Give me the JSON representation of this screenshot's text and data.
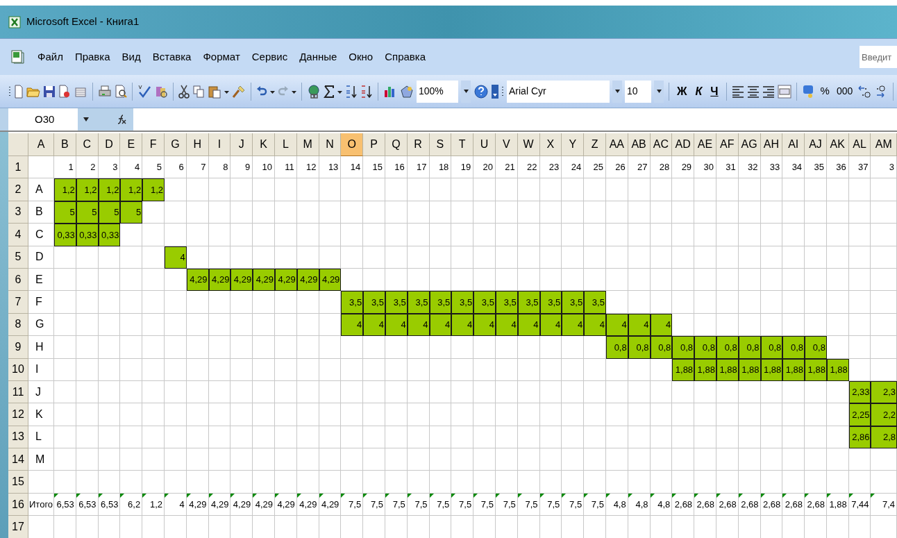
{
  "window": {
    "title": "Microsoft Excel - Книга1"
  },
  "menu": [
    "Файл",
    "Правка",
    "Вид",
    "Вставка",
    "Формат",
    "Сервис",
    "Данные",
    "Окно",
    "Справка"
  ],
  "help_search": {
    "placeholder": "Введит"
  },
  "toolbar": {
    "zoom": "100%",
    "font": "Arial Cyr",
    "font_size": "10",
    "bold": "Ж",
    "italic": "К",
    "underline": "Ч",
    "percent": "%",
    "thousands": "000"
  },
  "formula_bar": {
    "name_box": "O30"
  },
  "sheet": {
    "columns": [
      {
        "label": "A",
        "selected": false
      },
      {
        "label": "B",
        "selected": false
      },
      {
        "label": "C",
        "selected": false
      },
      {
        "label": "D",
        "selected": false
      },
      {
        "label": "E",
        "selected": false
      },
      {
        "label": "F",
        "selected": false
      },
      {
        "label": "G",
        "selected": false
      },
      {
        "label": "H",
        "selected": false
      },
      {
        "label": "I",
        "selected": false
      },
      {
        "label": "J",
        "selected": false
      },
      {
        "label": "K",
        "selected": false
      },
      {
        "label": "L",
        "selected": false
      },
      {
        "label": "M",
        "selected": false
      },
      {
        "label": "N",
        "selected": false
      },
      {
        "label": "O",
        "selected": true
      },
      {
        "label": "P",
        "selected": false
      },
      {
        "label": "Q",
        "selected": false
      },
      {
        "label": "R",
        "selected": false
      },
      {
        "label": "S",
        "selected": false
      },
      {
        "label": "T",
        "selected": false
      },
      {
        "label": "U",
        "selected": false
      },
      {
        "label": "V",
        "selected": false
      },
      {
        "label": "W",
        "selected": false
      },
      {
        "label": "X",
        "selected": false
      },
      {
        "label": "Y",
        "selected": false
      },
      {
        "label": "Z",
        "selected": false
      },
      {
        "label": "AA",
        "selected": false
      },
      {
        "label": "AB",
        "selected": false
      },
      {
        "label": "AC",
        "selected": false
      },
      {
        "label": "AD",
        "selected": false
      },
      {
        "label": "AE",
        "selected": false
      },
      {
        "label": "AF",
        "selected": false
      },
      {
        "label": "AG",
        "selected": false
      },
      {
        "label": "AH",
        "selected": false
      },
      {
        "label": "AI",
        "selected": false
      },
      {
        "label": "AJ",
        "selected": false
      },
      {
        "label": "AK",
        "selected": false
      },
      {
        "label": "AL",
        "selected": false
      },
      {
        "label": "AM",
        "selected": false
      }
    ],
    "rows": [
      {
        "header": "1",
        "flagged": false,
        "cells": [
          null,
          {
            "text": "1",
            "filled": false
          },
          {
            "text": "2",
            "filled": false
          },
          {
            "text": "3",
            "filled": false
          },
          {
            "text": "4",
            "filled": false
          },
          {
            "text": "5",
            "filled": false
          },
          {
            "text": "6",
            "filled": false
          },
          {
            "text": "7",
            "filled": false
          },
          {
            "text": "8",
            "filled": false
          },
          {
            "text": "9",
            "filled": false
          },
          {
            "text": "10",
            "filled": false
          },
          {
            "text": "11",
            "filled": false
          },
          {
            "text": "12",
            "filled": false
          },
          {
            "text": "13",
            "filled": false
          },
          {
            "text": "14",
            "filled": false
          },
          {
            "text": "15",
            "filled": false
          },
          {
            "text": "16",
            "filled": false
          },
          {
            "text": "17",
            "filled": false
          },
          {
            "text": "18",
            "filled": false
          },
          {
            "text": "19",
            "filled": false
          },
          {
            "text": "20",
            "filled": false
          },
          {
            "text": "21",
            "filled": false
          },
          {
            "text": "22",
            "filled": false
          },
          {
            "text": "23",
            "filled": false
          },
          {
            "text": "24",
            "filled": false
          },
          {
            "text": "25",
            "filled": false
          },
          {
            "text": "26",
            "filled": false
          },
          {
            "text": "27",
            "filled": false
          },
          {
            "text": "28",
            "filled": false
          },
          {
            "text": "29",
            "filled": false
          },
          {
            "text": "30",
            "filled": false
          },
          {
            "text": "31",
            "filled": false
          },
          {
            "text": "32",
            "filled": false
          },
          {
            "text": "33",
            "filled": false
          },
          {
            "text": "34",
            "filled": false
          },
          {
            "text": "35",
            "filled": false
          },
          {
            "text": "36",
            "filled": false
          },
          {
            "text": "37",
            "filled": false
          },
          {
            "text": "3",
            "filled": false
          }
        ]
      },
      {
        "header": "2",
        "flagged": false,
        "cells": [
          {
            "text": "A",
            "filled": false
          },
          {
            "text": "1,2",
            "filled": true
          },
          {
            "text": "1,2",
            "filled": true
          },
          {
            "text": "1,2",
            "filled": true
          },
          {
            "text": "1,2",
            "filled": true
          },
          {
            "text": "1,2",
            "filled": true
          }
        ]
      },
      {
        "header": "3",
        "flagged": false,
        "cells": [
          {
            "text": "B",
            "filled": false
          },
          {
            "text": "5",
            "filled": true
          },
          {
            "text": "5",
            "filled": true
          },
          {
            "text": "5",
            "filled": true
          },
          {
            "text": "5",
            "filled": true
          }
        ]
      },
      {
        "header": "4",
        "flagged": false,
        "cells": [
          {
            "text": "C",
            "filled": false
          },
          {
            "text": "0,33",
            "filled": true
          },
          {
            "text": "0,33",
            "filled": true
          },
          {
            "text": "0,33",
            "filled": true
          }
        ]
      },
      {
        "header": "5",
        "flagged": false,
        "cells": [
          {
            "text": "D",
            "filled": false
          },
          null,
          null,
          null,
          null,
          null,
          {
            "text": "4",
            "filled": true
          }
        ]
      },
      {
        "header": "6",
        "flagged": false,
        "cells": [
          {
            "text": "E",
            "filled": false
          },
          null,
          null,
          null,
          null,
          null,
          null,
          {
            "text": "4,29",
            "filled": true
          },
          {
            "text": "4,29",
            "filled": true
          },
          {
            "text": "4,29",
            "filled": true
          },
          {
            "text": "4,29",
            "filled": true
          },
          {
            "text": "4,29",
            "filled": true
          },
          {
            "text": "4,29",
            "filled": true
          },
          {
            "text": "4,29",
            "filled": true
          }
        ]
      },
      {
        "header": "7",
        "flagged": false,
        "cells": [
          {
            "text": "F",
            "filled": false
          },
          null,
          null,
          null,
          null,
          null,
          null,
          null,
          null,
          null,
          null,
          null,
          null,
          null,
          {
            "text": "3,5",
            "filled": true
          },
          {
            "text": "3,5",
            "filled": true
          },
          {
            "text": "3,5",
            "filled": true
          },
          {
            "text": "3,5",
            "filled": true
          },
          {
            "text": "3,5",
            "filled": true
          },
          {
            "text": "3,5",
            "filled": true
          },
          {
            "text": "3,5",
            "filled": true
          },
          {
            "text": "3,5",
            "filled": true
          },
          {
            "text": "3,5",
            "filled": true
          },
          {
            "text": "3,5",
            "filled": true
          },
          {
            "text": "3,5",
            "filled": true
          },
          {
            "text": "3,5",
            "filled": true
          }
        ]
      },
      {
        "header": "8",
        "flagged": false,
        "cells": [
          {
            "text": "G",
            "filled": false
          },
          null,
          null,
          null,
          null,
          null,
          null,
          null,
          null,
          null,
          null,
          null,
          null,
          null,
          {
            "text": "4",
            "filled": true
          },
          {
            "text": "4",
            "filled": true
          },
          {
            "text": "4",
            "filled": true
          },
          {
            "text": "4",
            "filled": true
          },
          {
            "text": "4",
            "filled": true
          },
          {
            "text": "4",
            "filled": true
          },
          {
            "text": "4",
            "filled": true
          },
          {
            "text": "4",
            "filled": true
          },
          {
            "text": "4",
            "filled": true
          },
          {
            "text": "4",
            "filled": true
          },
          {
            "text": "4",
            "filled": true
          },
          {
            "text": "4",
            "filled": true
          },
          {
            "text": "4",
            "filled": true
          },
          {
            "text": "4",
            "filled": true
          },
          {
            "text": "4",
            "filled": true
          }
        ]
      },
      {
        "header": "9",
        "flagged": false,
        "cells": [
          {
            "text": "H",
            "filled": false
          },
          null,
          null,
          null,
          null,
          null,
          null,
          null,
          null,
          null,
          null,
          null,
          null,
          null,
          null,
          null,
          null,
          null,
          null,
          null,
          null,
          null,
          null,
          null,
          null,
          null,
          {
            "text": "0,8",
            "filled": true
          },
          {
            "text": "0,8",
            "filled": true
          },
          {
            "text": "0,8",
            "filled": true
          },
          {
            "text": "0,8",
            "filled": true
          },
          {
            "text": "0,8",
            "filled": true
          },
          {
            "text": "0,8",
            "filled": true
          },
          {
            "text": "0,8",
            "filled": true
          },
          {
            "text": "0,8",
            "filled": true
          },
          {
            "text": "0,8",
            "filled": true
          },
          {
            "text": "0,8",
            "filled": true
          }
        ]
      },
      {
        "header": "10",
        "flagged": false,
        "cells": [
          {
            "text": "I",
            "filled": false
          },
          null,
          null,
          null,
          null,
          null,
          null,
          null,
          null,
          null,
          null,
          null,
          null,
          null,
          null,
          null,
          null,
          null,
          null,
          null,
          null,
          null,
          null,
          null,
          null,
          null,
          null,
          null,
          null,
          {
            "text": "1,88",
            "filled": true
          },
          {
            "text": "1,88",
            "filled": true
          },
          {
            "text": "1,88",
            "filled": true
          },
          {
            "text": "1,88",
            "filled": true
          },
          {
            "text": "1,88",
            "filled": true
          },
          {
            "text": "1,88",
            "filled": true
          },
          {
            "text": "1,88",
            "filled": true
          },
          {
            "text": "1,88",
            "filled": true
          }
        ]
      },
      {
        "header": "11",
        "flagged": false,
        "cells": [
          {
            "text": "J",
            "filled": false
          },
          null,
          null,
          null,
          null,
          null,
          null,
          null,
          null,
          null,
          null,
          null,
          null,
          null,
          null,
          null,
          null,
          null,
          null,
          null,
          null,
          null,
          null,
          null,
          null,
          null,
          null,
          null,
          null,
          null,
          null,
          null,
          null,
          null,
          null,
          null,
          null,
          {
            "text": "2,33",
            "filled": true
          },
          {
            "text": "2,3",
            "filled": true
          }
        ]
      },
      {
        "header": "12",
        "flagged": false,
        "cells": [
          {
            "text": "K",
            "filled": false
          },
          null,
          null,
          null,
          null,
          null,
          null,
          null,
          null,
          null,
          null,
          null,
          null,
          null,
          null,
          null,
          null,
          null,
          null,
          null,
          null,
          null,
          null,
          null,
          null,
          null,
          null,
          null,
          null,
          null,
          null,
          null,
          null,
          null,
          null,
          null,
          null,
          {
            "text": "2,25",
            "filled": true
          },
          {
            "text": "2,2",
            "filled": true
          }
        ]
      },
      {
        "header": "13",
        "flagged": false,
        "cells": [
          {
            "text": "L",
            "filled": false
          },
          null,
          null,
          null,
          null,
          null,
          null,
          null,
          null,
          null,
          null,
          null,
          null,
          null,
          null,
          null,
          null,
          null,
          null,
          null,
          null,
          null,
          null,
          null,
          null,
          null,
          null,
          null,
          null,
          null,
          null,
          null,
          null,
          null,
          null,
          null,
          null,
          {
            "text": "2,86",
            "filled": true
          },
          {
            "text": "2,8",
            "filled": true
          }
        ]
      },
      {
        "header": "14",
        "flagged": false,
        "cells": [
          {
            "text": "M",
            "filled": false
          }
        ]
      },
      {
        "header": "15",
        "flagged": false
      },
      {
        "header": "16",
        "flagged": true,
        "cells": [
          {
            "text": "Итого",
            "filled": false
          },
          {
            "text": "6,53",
            "filled": false
          },
          {
            "text": "6,53",
            "filled": false
          },
          {
            "text": "6,53",
            "filled": false
          },
          {
            "text": "6,2",
            "filled": false
          },
          {
            "text": "1,2",
            "filled": false
          },
          {
            "text": "4",
            "filled": false
          },
          {
            "text": "4,29",
            "filled": false
          },
          {
            "text": "4,29",
            "filled": false
          },
          {
            "text": "4,29",
            "filled": false
          },
          {
            "text": "4,29",
            "filled": false
          },
          {
            "text": "4,29",
            "filled": false
          },
          {
            "text": "4,29",
            "filled": false
          },
          {
            "text": "4,29",
            "filled": false
          },
          {
            "text": "7,5",
            "filled": false
          },
          {
            "text": "7,5",
            "filled": false
          },
          {
            "text": "7,5",
            "filled": false
          },
          {
            "text": "7,5",
            "filled": false
          },
          {
            "text": "7,5",
            "filled": false
          },
          {
            "text": "7,5",
            "filled": false
          },
          {
            "text": "7,5",
            "filled": false
          },
          {
            "text": "7,5",
            "filled": false
          },
          {
            "text": "7,5",
            "filled": false
          },
          {
            "text": "7,5",
            "filled": false
          },
          {
            "text": "7,5",
            "filled": false
          },
          {
            "text": "7,5",
            "filled": false
          },
          {
            "text": "4,8",
            "filled": false
          },
          {
            "text": "4,8",
            "filled": false
          },
          {
            "text": "4,8",
            "filled": false
          },
          {
            "text": "2,68",
            "filled": false
          },
          {
            "text": "2,68",
            "filled": false
          },
          {
            "text": "2,68",
            "filled": false
          },
          {
            "text": "2,68",
            "filled": false
          },
          {
            "text": "2,68",
            "filled": false
          },
          {
            "text": "2,68",
            "filled": false
          },
          {
            "text": "2,68",
            "filled": false
          },
          {
            "text": "1,88",
            "filled": false
          },
          {
            "text": "7,44",
            "filled": false
          },
          {
            "text": "7,4",
            "filled": false
          }
        ]
      },
      {
        "header": "17",
        "flagged": false
      }
    ]
  }
}
